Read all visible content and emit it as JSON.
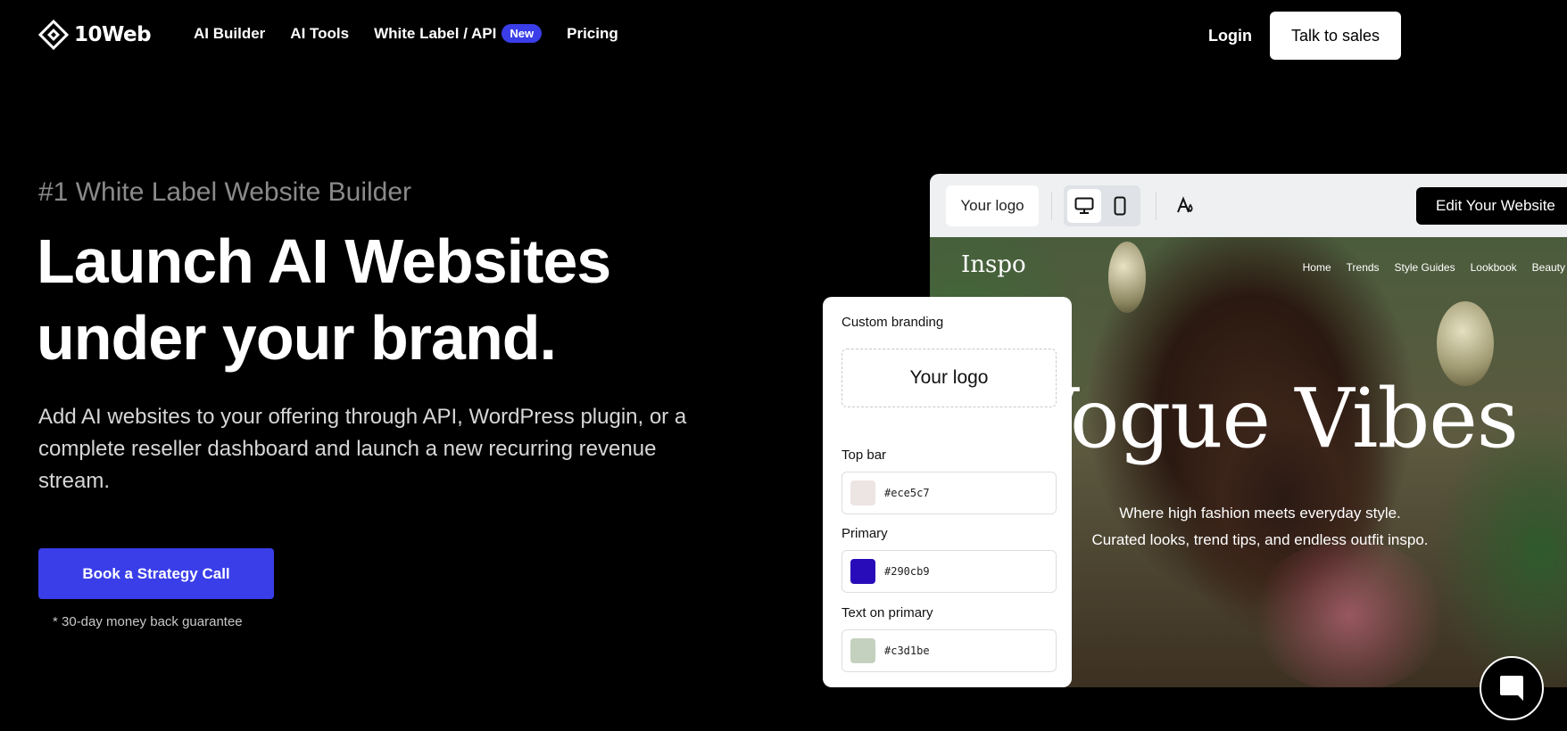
{
  "brand": {
    "name": "10Web"
  },
  "nav": {
    "items": [
      "AI Builder",
      "AI Tools",
      "White Label / API",
      "Pricing"
    ],
    "badge": "New",
    "login": "Login",
    "sales": "Talk to sales"
  },
  "hero": {
    "kicker": "#1 White Label Website Builder",
    "headline": "Launch AI Websites under your brand.",
    "subtext": "Add AI websites to your offering through API, WordPress plugin, or a complete reseller dashboard and launch a new recurring revenue stream.",
    "cta": "Book a Strategy Call",
    "guarantee": "* 30-day money back guarantee"
  },
  "preview": {
    "logo_placeholder": "Your logo",
    "edit_button": "Edit Your Website",
    "site": {
      "logo": "Inspo",
      "nav": [
        "Home",
        "Trends",
        "Style Guides",
        "Lookbook",
        "Beauty"
      ],
      "title": "Vogue Vibes",
      "tagline_1": "Where high fashion meets everyday style.",
      "tagline_2": "Curated looks, trend tips, and endless outfit inspo."
    }
  },
  "branding_panel": {
    "title": "Custom branding",
    "logo_placeholder": "Your logo",
    "fields": [
      {
        "label": "Top bar",
        "value": "#ece5c7",
        "swatch": "#ece5e3"
      },
      {
        "label": "Primary",
        "value": "#290cb9",
        "swatch": "#290cb9"
      },
      {
        "label": "Text on primary",
        "value": "#c3d1be",
        "swatch": "#c3d1be"
      }
    ]
  },
  "colors": {
    "accent": "#3a3ee8",
    "background": "#000000"
  },
  "icons": [
    "logo-icon",
    "desktop-icon",
    "mobile-icon",
    "style-icon",
    "chat-icon"
  ]
}
